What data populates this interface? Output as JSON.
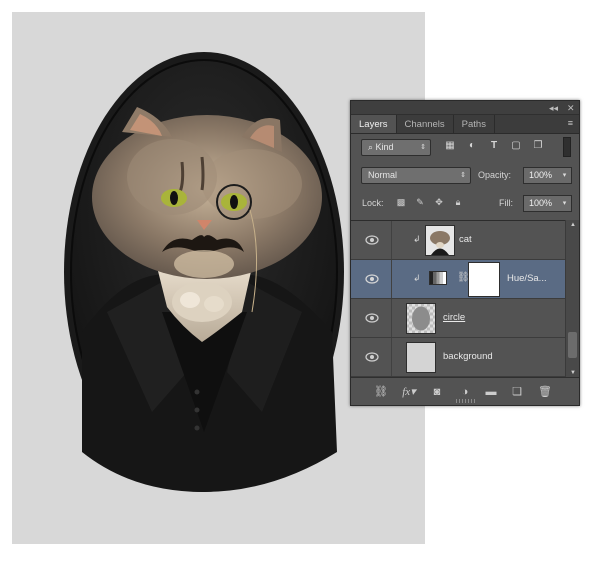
{
  "panel": {
    "tabs": [
      {
        "label": "Layers",
        "active": true
      },
      {
        "label": "Channels",
        "active": false
      },
      {
        "label": "Paths",
        "active": false
      }
    ],
    "collapse_glyph": "◂◂",
    "close_glyph": "✕",
    "menu_glyph": "≡",
    "filter": {
      "kind_label": "Kind",
      "icons": [
        "image-filter-icon",
        "adjustment-filter-icon",
        "type-filter-icon",
        "shape-filter-icon",
        "smart-object-filter-icon"
      ]
    },
    "blend": {
      "mode": "Normal",
      "opacity_label": "Opacity:",
      "opacity_value": "100%"
    },
    "lock": {
      "label": "Lock:",
      "fill_label": "Fill:",
      "fill_value": "100%"
    },
    "layers": [
      {
        "name": "cat",
        "clipped": true,
        "selected": false,
        "type": "pixel"
      },
      {
        "name": "Hue/Sa...",
        "clipped": true,
        "selected": true,
        "type": "adjustment"
      },
      {
        "name": "circle",
        "clipped": false,
        "selected": false,
        "type": "shape"
      },
      {
        "name": "background",
        "clipped": false,
        "selected": false,
        "type": "pixel"
      }
    ],
    "bottom_icons": [
      "link-icon",
      "fx-icon",
      "mask-icon",
      "adjustment-icon",
      "folder-icon",
      "new-layer-icon",
      "trash-icon"
    ],
    "fx_label": "fx"
  },
  "colors": {
    "panel_bg": "#535353",
    "selected_layer": "#5a6b84",
    "canvas_bg": "#d8d8d8"
  }
}
